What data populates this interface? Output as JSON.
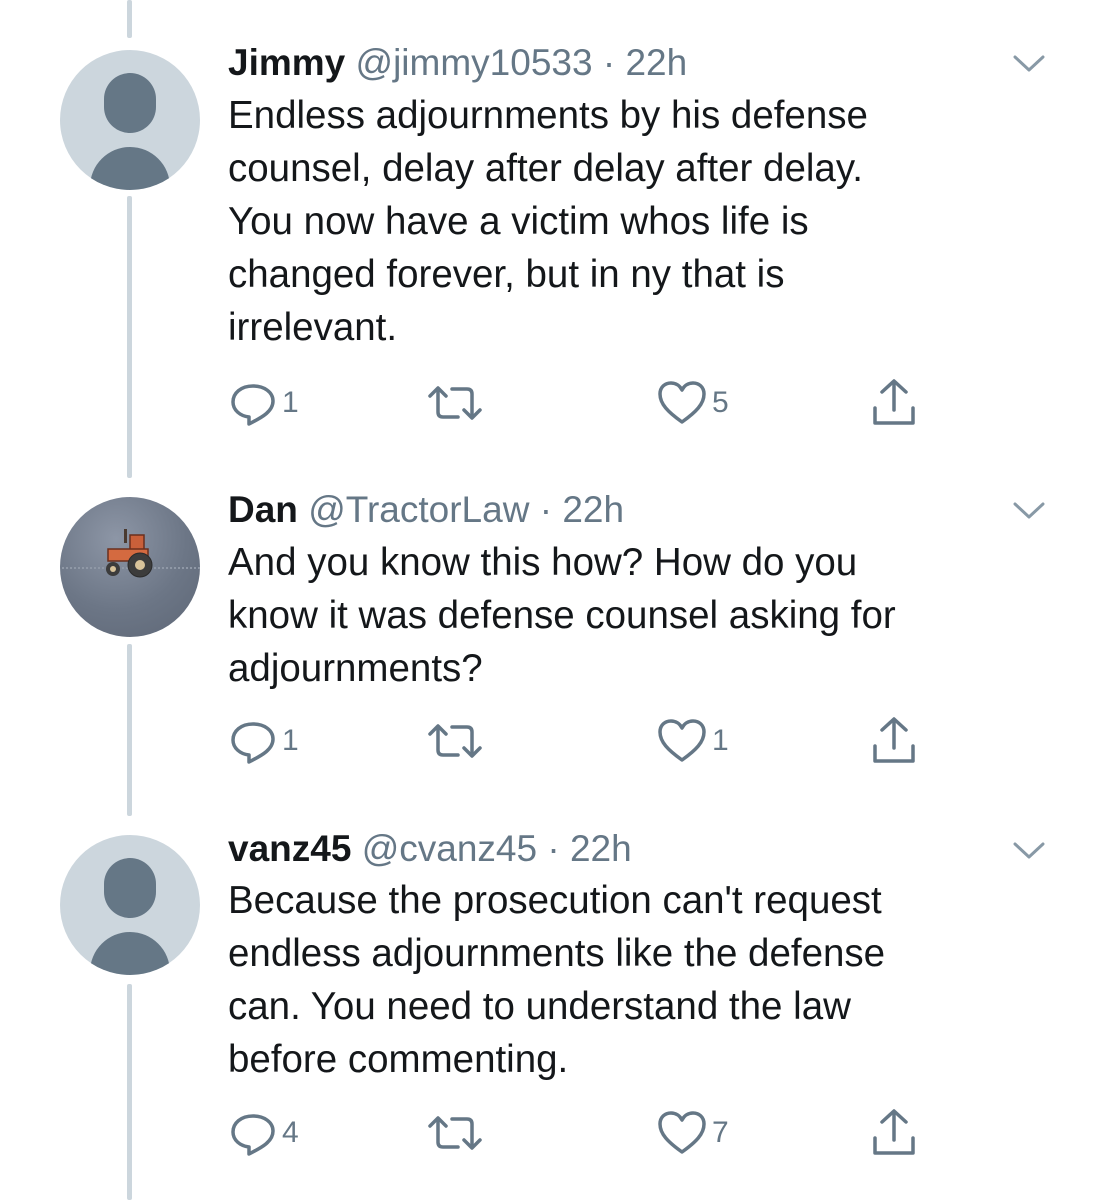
{
  "tweets": [
    {
      "display_name": "Jimmy",
      "handle": "@jimmy10533",
      "separator": "·",
      "time": "22h",
      "text": "Endless adjournments by his defense\ncounsel, delay after delay after delay.\nYou now have a victim whos life is\nchanged forever, but in ny that is\nirrelevant.",
      "reply_count": "1",
      "retweet_count": "",
      "like_count": "5",
      "avatar": "default-avatar"
    },
    {
      "display_name": "Dan",
      "handle": "@TractorLaw",
      "separator": "·",
      "time": "22h",
      "text": "And you know this how? How do you\nknow it was defense counsel asking for\nadjournments?",
      "reply_count": "1",
      "retweet_count": "",
      "like_count": "1",
      "avatar": "tractor-photo"
    },
    {
      "display_name": "vanz45",
      "handle": "@cvanz45",
      "separator": "·",
      "time": "22h",
      "text": "Because the prosecution can't request\nendless adjournments like the defense\ncan. You need to understand the law\nbefore commenting.",
      "reply_count": "4",
      "retweet_count": "",
      "like_count": "7",
      "avatar": "default-avatar"
    }
  ],
  "icons": {
    "reply": "reply-icon",
    "retweet": "retweet-icon",
    "like": "heart-icon",
    "share": "share-icon",
    "menu": "chevron-down-icon"
  },
  "colors": {
    "text": "#14171a",
    "secondary": "#657786",
    "thread_line": "#ccd6dd",
    "avatar_bg": "#ccd6dd",
    "avatar_fg": "#657786"
  }
}
